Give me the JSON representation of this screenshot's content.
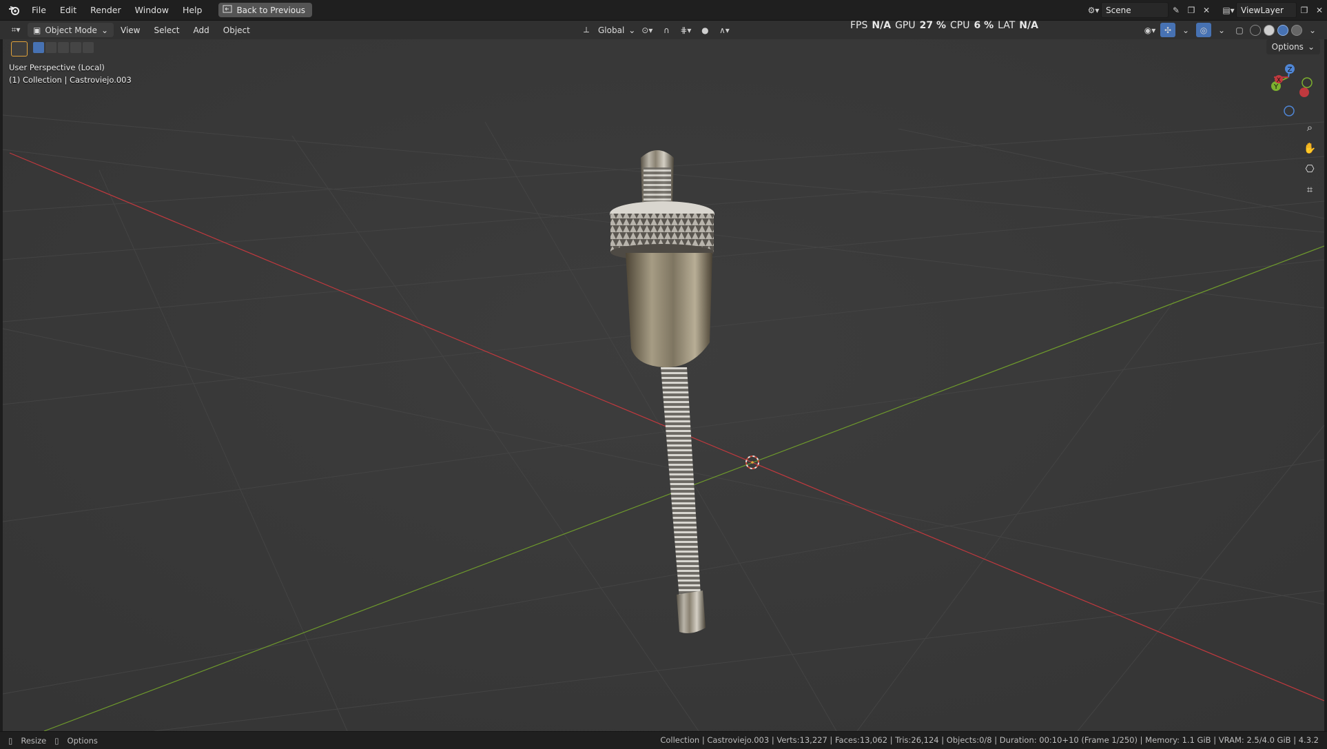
{
  "menubar": {
    "items": [
      "File",
      "Edit",
      "Render",
      "Window",
      "Help"
    ],
    "back_label": "Back to Previous",
    "scene": "Scene",
    "view_layer": "ViewLayer"
  },
  "view_header": {
    "mode": "Object Mode",
    "menus": [
      "View",
      "Select",
      "Add",
      "Object"
    ],
    "transform_orientation": "Global",
    "options_label": "Options"
  },
  "stats": {
    "fps_label": "FPS",
    "fps_value": "N/A",
    "gpu_label": "GPU",
    "gpu_value": "27 %",
    "cpu_label": "CPU",
    "cpu_value": "6 %",
    "lat_label": "LAT",
    "lat_value": "N/A"
  },
  "viewport": {
    "perspective": "User Perspective (Local)",
    "collection": "(1) Collection | Castroviejo.003"
  },
  "gizmo": {
    "z": "Z",
    "y": "Y",
    "x": "X"
  },
  "statusbar": {
    "resize": "Resize",
    "options": "Options",
    "info": "Collection | Castroviejo.003 | Verts:13,227 | Faces:13,062 | Tris:26,124 | Objects:0/8 | Duration: 00:10+10 (Frame 1/250) | Memory: 1.1 GiB | VRAM: 2.5/4.0 GiB | 4.3.2"
  },
  "colors": {
    "x_axis": "#c0393e",
    "y_axis": "#6f9b2c",
    "accent": "#4772b3"
  }
}
